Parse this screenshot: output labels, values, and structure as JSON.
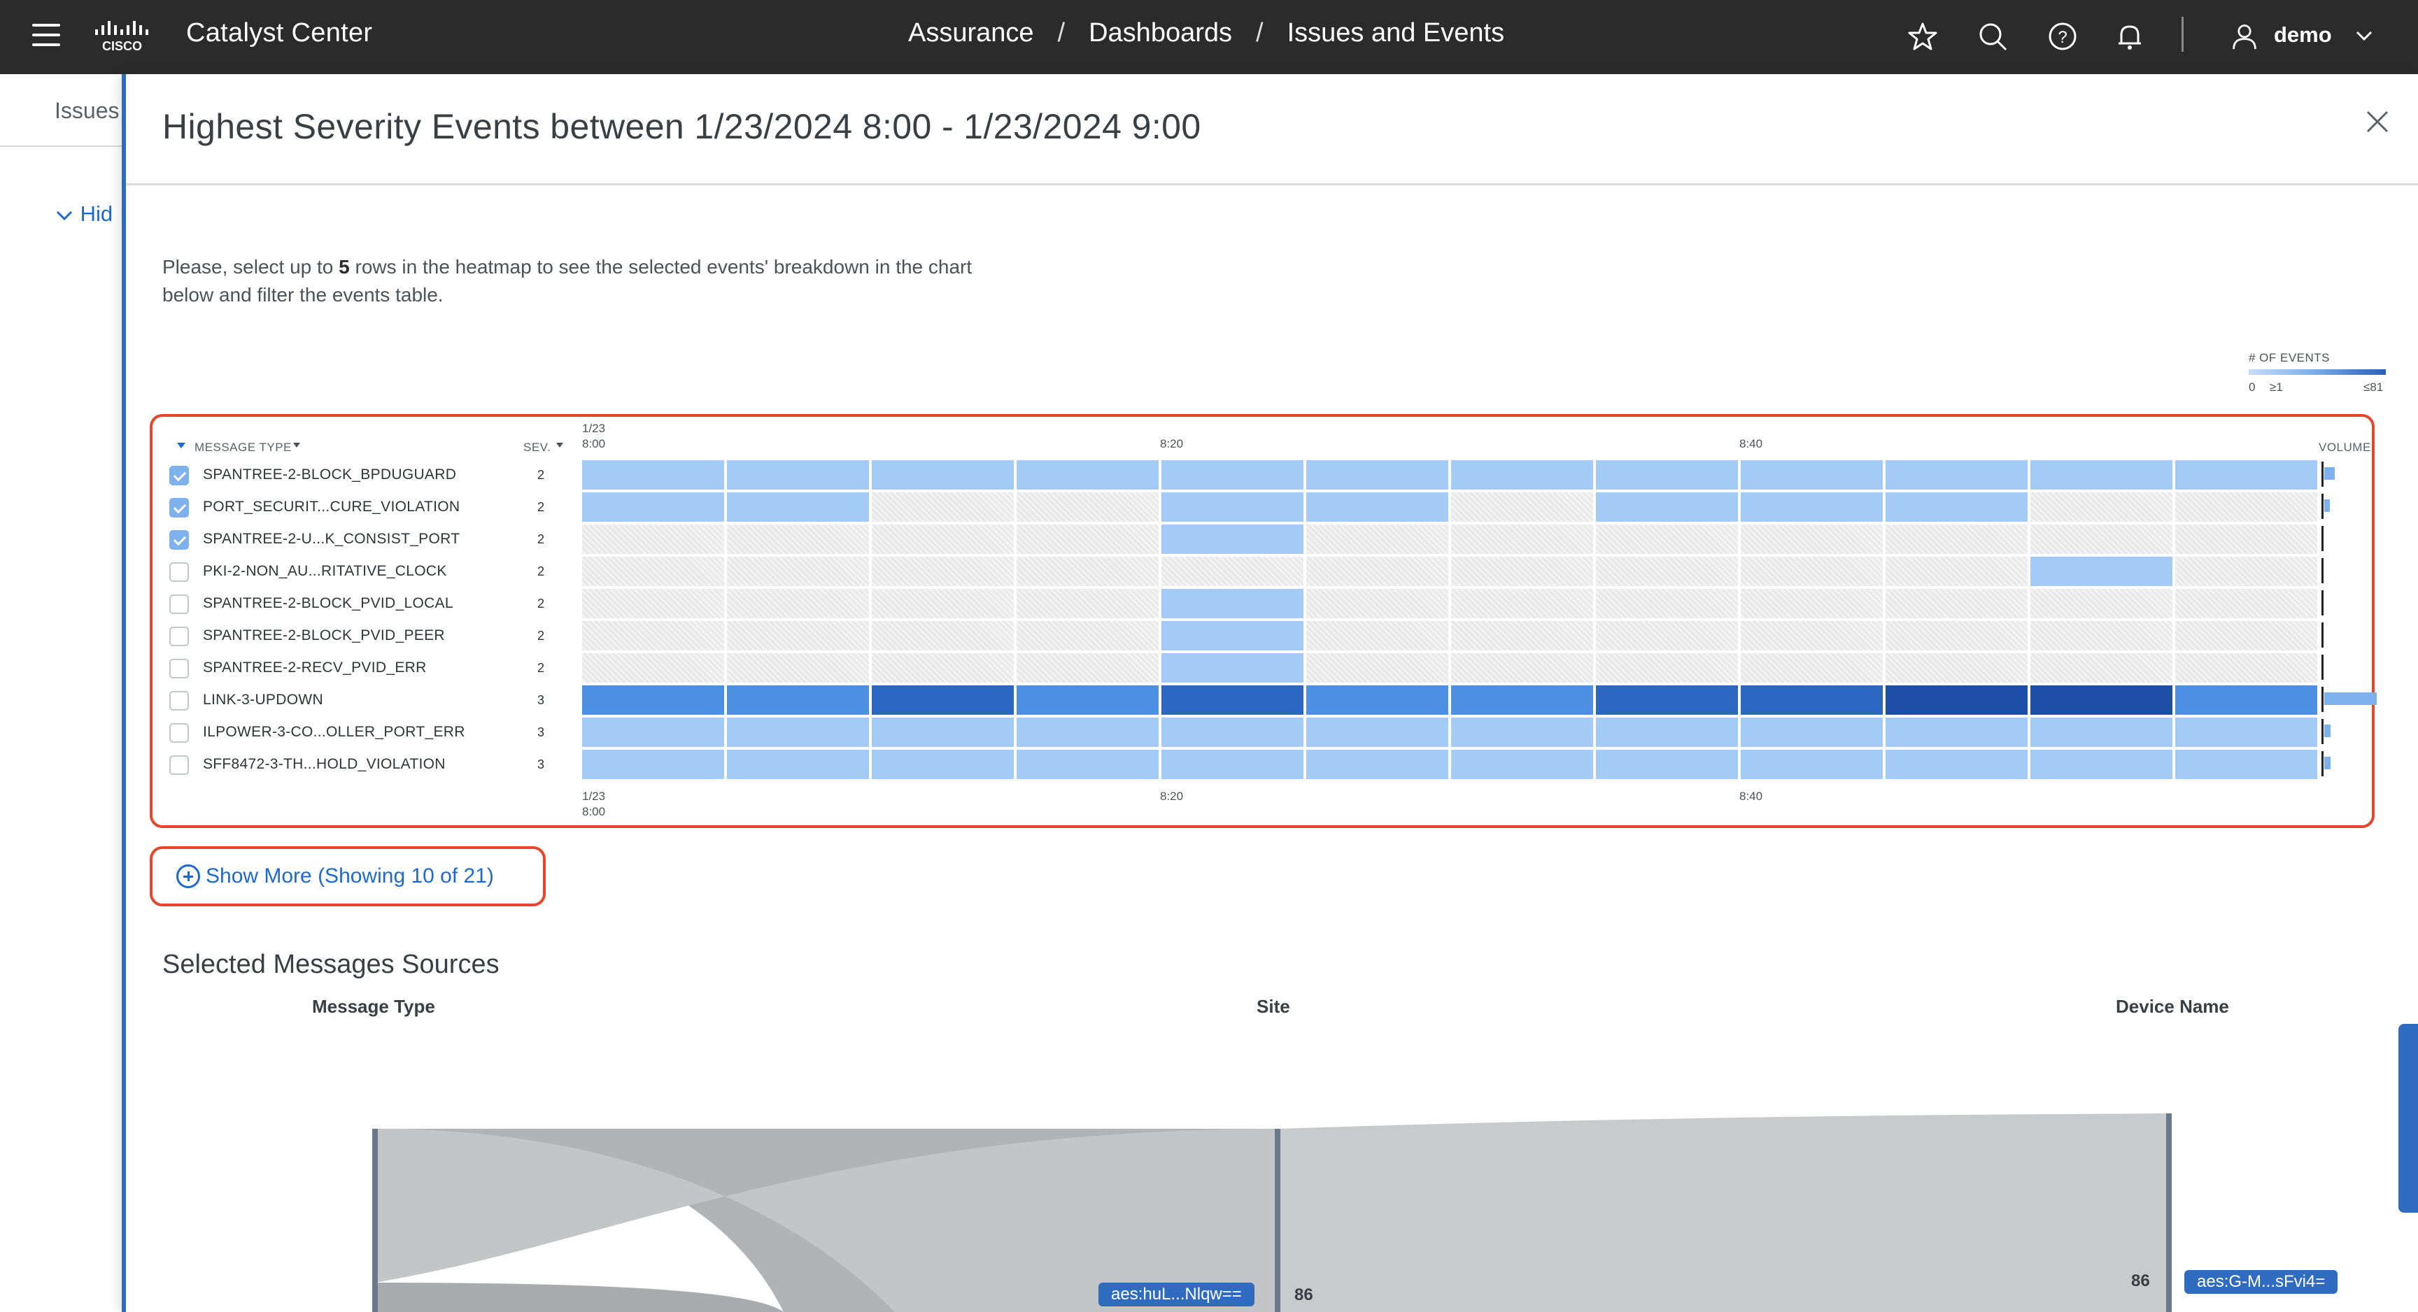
{
  "app": {
    "title": "Catalyst Center",
    "breadcrumbs": [
      "Assurance",
      "Dashboards",
      "Issues and Events"
    ],
    "user": "demo",
    "brand_color": "#2b2b2b",
    "accent_color": "#1d69cc"
  },
  "topbar_icons": [
    "menu-icon",
    "cisco-logo",
    "star-icon",
    "search-icon",
    "help-icon",
    "bell-icon",
    "user-icon",
    "chevron-down-icon"
  ],
  "background_page": {
    "tab_label": "Issues",
    "hide_label": "Hid"
  },
  "panel": {
    "title": "Highest Severity Events between 1/23/2024 8:00 - 1/23/2024 9:00",
    "instructions_prefix": "Please, select up to ",
    "instructions_count": "5",
    "instructions_suffix": " rows in the heatmap to see the selected events' breakdown in the chart below and filter the events table."
  },
  "legend": {
    "title": "# OF EVENTS",
    "min": "0",
    "low": "≥1",
    "max": "≤81"
  },
  "heatmap": {
    "col_message_type": "MESSAGE TYPE",
    "col_severity": "SEV.",
    "col_volume": "VOLUME",
    "axis_top_date": "1/23",
    "time_labels": [
      "8:00",
      "8:20",
      "8:40"
    ],
    "colors": {
      "light": "#a4cbf5",
      "medium": "#4d8fe0",
      "dark": "#2c66c2",
      "darkest": "#1e4fa6"
    },
    "rows": [
      {
        "name": "SPANTREE-2-BLOCK_BPDUGUARD",
        "sev": "2",
        "checked": true,
        "cells": [
          "light",
          "light",
          "light",
          "light",
          "light",
          "light",
          "light",
          "light",
          "light",
          "light",
          "light",
          "light"
        ],
        "volume": 0.05
      },
      {
        "name": "PORT_SECURIT...CURE_VIOLATION",
        "sev": "2",
        "checked": true,
        "cells": [
          "light",
          "light",
          "empty",
          "empty",
          "light",
          "light",
          "empty",
          "light",
          "light",
          "light",
          "empty",
          "empty"
        ],
        "volume": 0.02
      },
      {
        "name": "SPANTREE-2-U...K_CONSIST_PORT",
        "sev": "2",
        "checked": true,
        "cells": [
          "empty",
          "empty",
          "empty",
          "empty",
          "light",
          "empty",
          "empty",
          "empty",
          "empty",
          "empty",
          "empty",
          "empty"
        ],
        "volume": 0.0
      },
      {
        "name": "PKI-2-NON_AU...RITATIVE_CLOCK",
        "sev": "2",
        "checked": false,
        "cells": [
          "empty",
          "empty",
          "empty",
          "empty",
          "empty",
          "empty",
          "empty",
          "empty",
          "empty",
          "empty",
          "light",
          "empty"
        ],
        "volume": 0.0
      },
      {
        "name": "SPANTREE-2-BLOCK_PVID_LOCAL",
        "sev": "2",
        "checked": false,
        "cells": [
          "empty",
          "empty",
          "empty",
          "empty",
          "light",
          "empty",
          "empty",
          "empty",
          "empty",
          "empty",
          "empty",
          "empty"
        ],
        "volume": 0.0
      },
      {
        "name": "SPANTREE-2-BLOCK_PVID_PEER",
        "sev": "2",
        "checked": false,
        "cells": [
          "empty",
          "empty",
          "empty",
          "empty",
          "light",
          "empty",
          "empty",
          "empty",
          "empty",
          "empty",
          "empty",
          "empty"
        ],
        "volume": 0.0
      },
      {
        "name": "SPANTREE-2-RECV_PVID_ERR",
        "sev": "2",
        "checked": false,
        "cells": [
          "empty",
          "empty",
          "empty",
          "empty",
          "light",
          "empty",
          "empty",
          "empty",
          "empty",
          "empty",
          "empty",
          "empty"
        ],
        "volume": 0.0
      },
      {
        "name": "LINK-3-UPDOWN",
        "sev": "3",
        "checked": false,
        "cells": [
          "medium",
          "medium",
          "dark",
          "medium",
          "dark",
          "medium",
          "medium",
          "dark",
          "dark",
          "darkest",
          "darkest",
          "medium"
        ],
        "volume": 0.25
      },
      {
        "name": "ILPOWER-3-CO...OLLER_PORT_ERR",
        "sev": "3",
        "checked": false,
        "cells": [
          "light",
          "light",
          "light",
          "light",
          "light",
          "light",
          "light",
          "light",
          "light",
          "light",
          "light",
          "light"
        ],
        "volume": 0.03
      },
      {
        "name": "SFF8472-3-TH...HOLD_VIOLATION",
        "sev": "3",
        "checked": false,
        "cells": [
          "light",
          "light",
          "light",
          "light",
          "light",
          "light",
          "light",
          "light",
          "light",
          "light",
          "light",
          "light"
        ],
        "volume": 0.03
      }
    ]
  },
  "show_more": {
    "label": "Show More (Showing 10 of 21)"
  },
  "sankey": {
    "title": "Selected Messages Sources",
    "columns": [
      "Message Type",
      "Site",
      "Device Name"
    ],
    "site_chip": "aes:huL...Nlqw==",
    "site_count": "86",
    "device_count": "86",
    "device_chip": "aes:G-M...sFvi4="
  }
}
